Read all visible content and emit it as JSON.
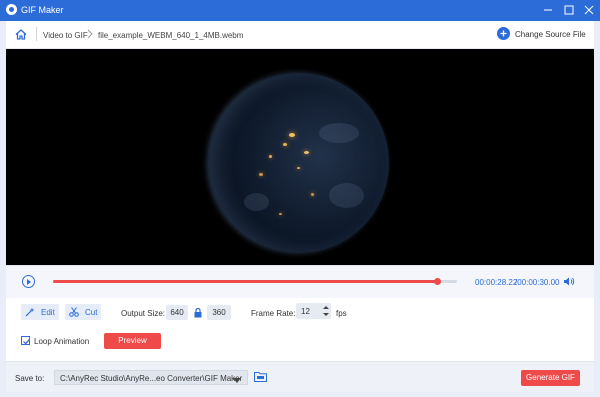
{
  "window": {
    "title": "GIF Maker",
    "accent": "#2c6cd9",
    "action_color": "#ee4a4a"
  },
  "breadcrumb": {
    "section": "Video to GIF",
    "file": "file_example_WEBM_640_1_4MB.webm"
  },
  "header": {
    "change_source_label": "Change Source File"
  },
  "player": {
    "current_time": "00:00:28.22",
    "total_time": "/00:00:30.00",
    "progress_fraction": 0.95
  },
  "tools": {
    "edit_label": "Edit",
    "cut_label": "Cut"
  },
  "output_size": {
    "label": "Output Size:",
    "width": "640",
    "height": "360"
  },
  "frame_rate": {
    "label": "Frame Rate:",
    "value": "12",
    "unit": "fps"
  },
  "loop": {
    "label": "Loop Animation",
    "checked": true
  },
  "preview": {
    "label": "Preview"
  },
  "save": {
    "label": "Save to:",
    "path": "C:\\AnyRec Studio\\AnyRe...eo Converter\\GIF Maker"
  },
  "generate": {
    "label": "Generate GIF"
  }
}
